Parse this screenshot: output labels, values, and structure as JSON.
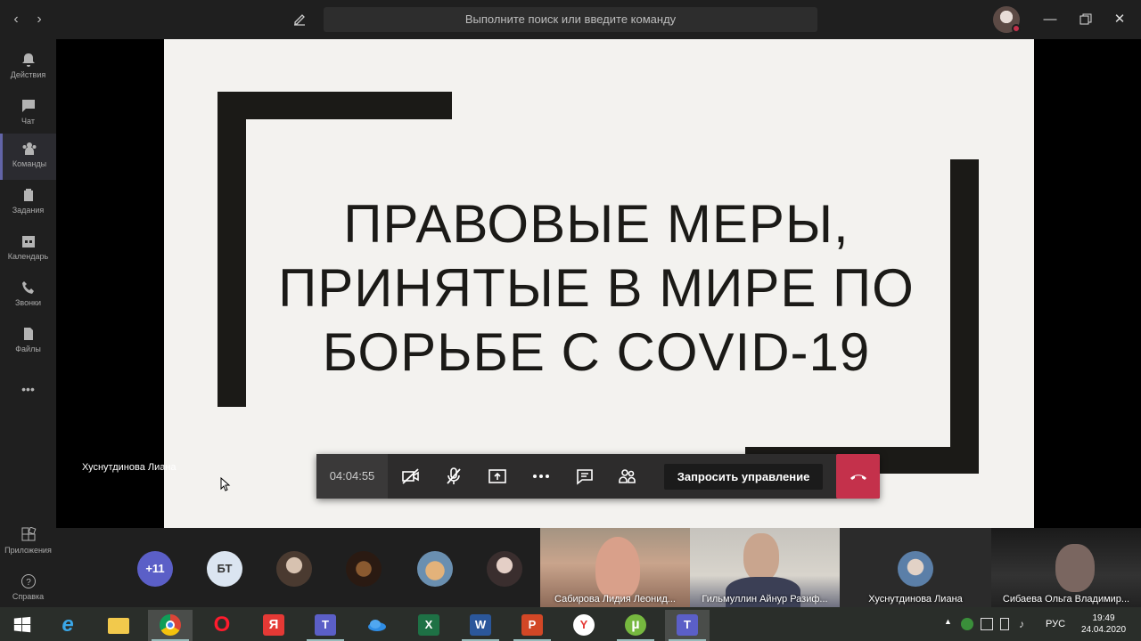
{
  "titlebar": {
    "search_placeholder": "Выполните поиск или введите команду"
  },
  "rail": {
    "items": [
      {
        "label": "Действия",
        "icon": "bell-icon"
      },
      {
        "label": "Чат",
        "icon": "chat-icon"
      },
      {
        "label": "Команды",
        "icon": "teams-icon",
        "active": true
      },
      {
        "label": "Задания",
        "icon": "assignments-icon"
      },
      {
        "label": "Календарь",
        "icon": "calendar-icon"
      },
      {
        "label": "Звонки",
        "icon": "phone-icon"
      },
      {
        "label": "Файлы",
        "icon": "files-icon"
      }
    ],
    "more": "•••",
    "apps": "Приложения",
    "help": "Справка"
  },
  "slide": {
    "title_lines": [
      "ПРАВОВЫЕ МЕРЫ,",
      "ПРИНЯТЫЕ В МИРЕ ПО",
      "БОРЬБЕ С COVID-19"
    ],
    "bg": "#f3f2ef",
    "bar_color": "#1b1a17"
  },
  "presenter": {
    "name": "Хуснутдинова Лиана"
  },
  "callbar": {
    "timer": "04:04:55",
    "request_control": "Запросить управление",
    "hangup_color": "#c4314b"
  },
  "participants": {
    "overflow": "+11",
    "initials": "БТ",
    "tiles": [
      {
        "name": "Сабирова Лидия Леонид..."
      },
      {
        "name": "Гильмуллин Айнур Разиф..."
      },
      {
        "name": "Хуснутдинова Лиана"
      },
      {
        "name": "Сибаева Ольга Владимир..."
      }
    ]
  },
  "taskbar": {
    "apps": [
      {
        "icon": "windows-start-icon"
      },
      {
        "icon": "ie-icon",
        "glyph": "e"
      },
      {
        "icon": "file-explorer-icon"
      },
      {
        "icon": "chrome-icon"
      },
      {
        "icon": "opera-icon",
        "glyph": "O"
      },
      {
        "icon": "yandex-icon",
        "glyph": "Я"
      },
      {
        "icon": "teams-icon-1",
        "glyph": "T"
      },
      {
        "icon": "onedrive-icon"
      },
      {
        "icon": "excel-icon",
        "glyph": "X"
      },
      {
        "icon": "word-icon",
        "glyph": "W"
      },
      {
        "icon": "powerpoint-icon",
        "glyph": "P"
      },
      {
        "icon": "yandex-browser-icon",
        "glyph": "Y"
      },
      {
        "icon": "utorrent-icon",
        "glyph": "µ"
      },
      {
        "icon": "teams-icon-2",
        "glyph": "T"
      }
    ],
    "lang": "РУС",
    "time": "19:49",
    "date": "24.04.2020"
  }
}
